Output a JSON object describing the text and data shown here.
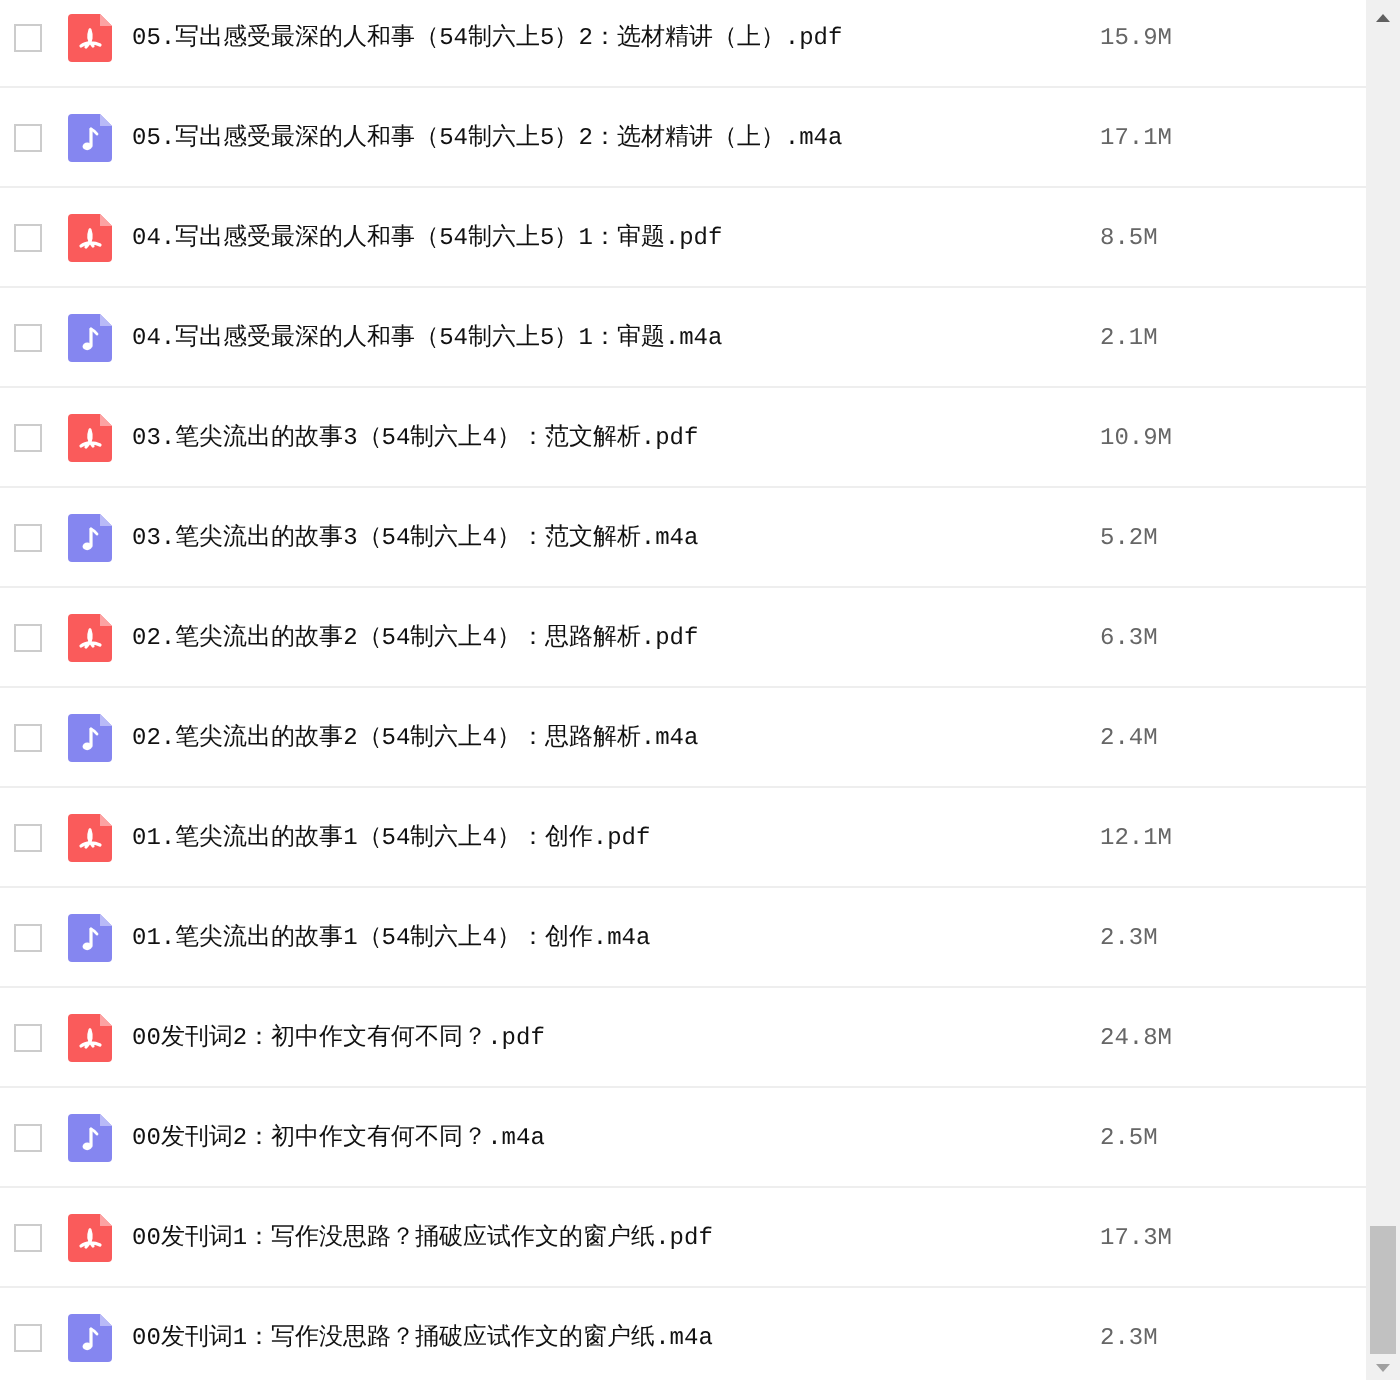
{
  "files": [
    {
      "kind": "pdf",
      "name": "05.写出感受最深的人和事（54制六上5）2：选材精讲（上）.pdf",
      "size": "15.9M",
      "checked": false
    },
    {
      "kind": "audio",
      "name": "05.写出感受最深的人和事（54制六上5）2：选材精讲（上）.m4a",
      "size": "17.1M",
      "checked": false
    },
    {
      "kind": "pdf",
      "name": "04.写出感受最深的人和事（54制六上5）1：审题.pdf",
      "size": "8.5M",
      "checked": false
    },
    {
      "kind": "audio",
      "name": "04.写出感受最深的人和事（54制六上5）1：审题.m4a",
      "size": "2.1M",
      "checked": false
    },
    {
      "kind": "pdf",
      "name": "03.笔尖流出的故事3（54制六上4）：范文解析.pdf",
      "size": "10.9M",
      "checked": false
    },
    {
      "kind": "audio",
      "name": "03.笔尖流出的故事3（54制六上4）：范文解析.m4a",
      "size": "5.2M",
      "checked": false
    },
    {
      "kind": "pdf",
      "name": "02.笔尖流出的故事2（54制六上4）：思路解析.pdf",
      "size": "6.3M",
      "checked": false
    },
    {
      "kind": "audio",
      "name": "02.笔尖流出的故事2（54制六上4）：思路解析.m4a",
      "size": "2.4M",
      "checked": false
    },
    {
      "kind": "pdf",
      "name": "01.笔尖流出的故事1（54制六上4）：创作.pdf",
      "size": "12.1M",
      "checked": false
    },
    {
      "kind": "audio",
      "name": "01.笔尖流出的故事1（54制六上4）：创作.m4a",
      "size": "2.3M",
      "checked": false
    },
    {
      "kind": "pdf",
      "name": "00发刊词2：初中作文有何不同？.pdf",
      "size": "24.8M",
      "checked": false
    },
    {
      "kind": "audio",
      "name": "00发刊词2：初中作文有何不同？.m4a",
      "size": "2.5M",
      "checked": false
    },
    {
      "kind": "pdf",
      "name": "00发刊词1：写作没思路？捅破应试作文的窗户纸.pdf",
      "size": "17.3M",
      "checked": false
    },
    {
      "kind": "audio",
      "name": "00发刊词1：写作没思路？捅破应试作文的窗户纸.m4a",
      "size": "2.3M",
      "checked": false
    }
  ]
}
